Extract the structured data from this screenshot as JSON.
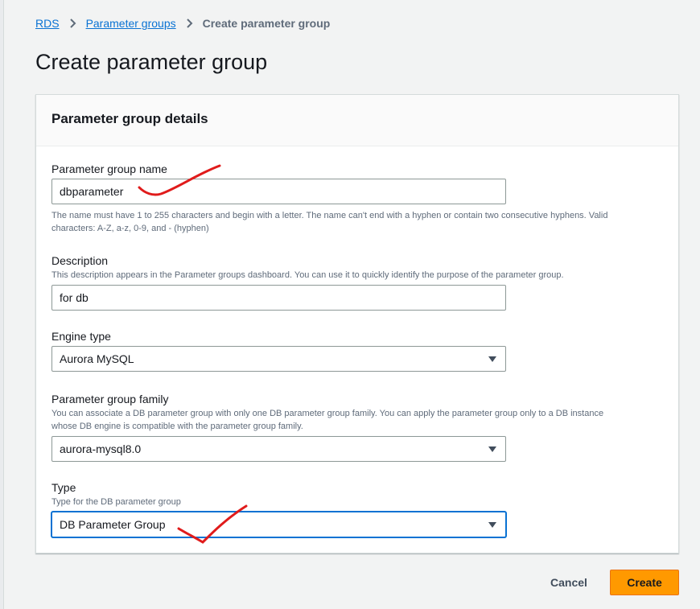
{
  "breadcrumb": {
    "root": "RDS",
    "parent": "Parameter groups",
    "current": "Create parameter group"
  },
  "page": {
    "title": "Create parameter group"
  },
  "container": {
    "header": "Parameter group details"
  },
  "fields": {
    "name": {
      "label": "Parameter group name",
      "value": "dbparameter",
      "constraint": "The name must have 1 to 255 characters and begin with a letter. The name can't end with a hyphen or contain two consecutive hyphens. Valid characters: A-Z, a-z, 0-9, and - (hyphen)"
    },
    "description": {
      "label": "Description",
      "hint": "This description appears in the Parameter groups dashboard. You can use it to quickly identify the purpose of the parameter group.",
      "value": "for db"
    },
    "engine_type": {
      "label": "Engine type",
      "value": "Aurora MySQL"
    },
    "family": {
      "label": "Parameter group family",
      "hint": "You can associate a DB parameter group with only one DB parameter group family. You can apply the parameter group only to a DB instance whose DB engine is compatible with the parameter group family.",
      "value": "aurora-mysql8.0"
    },
    "type": {
      "label": "Type",
      "hint": "Type for the DB parameter group",
      "value": "DB Parameter Group"
    }
  },
  "actions": {
    "cancel": "Cancel",
    "create": "Create"
  },
  "colors": {
    "primary_button": "#ff9900",
    "link": "#0972d3",
    "annotation": "#e01b1b"
  }
}
